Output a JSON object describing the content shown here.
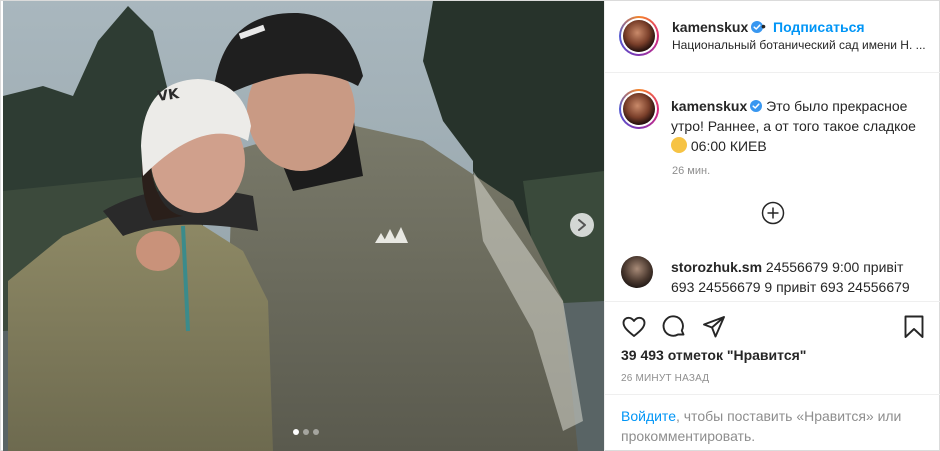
{
  "post": {
    "media": {
      "slide_count": 3,
      "active_slide": 1,
      "next_icon": "chevron-right-icon"
    },
    "header": {
      "username": "kamenskux",
      "separator": "•",
      "follow_label": "Подписаться",
      "location": "Национальный ботанический сад имени Н. ..."
    },
    "caption": {
      "username": "kamenskux",
      "text_line": "Это было прекрасное утро! Раннее, а от того такое сладкое",
      "text_tail": "06:00 КИЕВ",
      "time": "26 мин."
    },
    "load_more_icon": "plus-circle-icon",
    "comment": {
      "username": "storozhuk.sm",
      "text": "24556679 9:00 привіт 693 24556679 9 привіт 693 24556679"
    },
    "actions": {
      "like_icon": "heart-icon",
      "comment_icon": "comment-icon",
      "share_icon": "share-icon",
      "save_icon": "bookmark-icon"
    },
    "likes_text": "39 493 отметок \"Нравится\"",
    "posted_ago": "26 МИНУТ НАЗАД",
    "login_prompt": {
      "link": "Войдите",
      "text": ", чтобы поставить «Нравится» или прокомментировать."
    },
    "colors": {
      "link_blue": "#0095f6",
      "verified_blue": "#3897f0",
      "muted_text": "#8e8e8e",
      "border": "#dbdbdb"
    }
  }
}
